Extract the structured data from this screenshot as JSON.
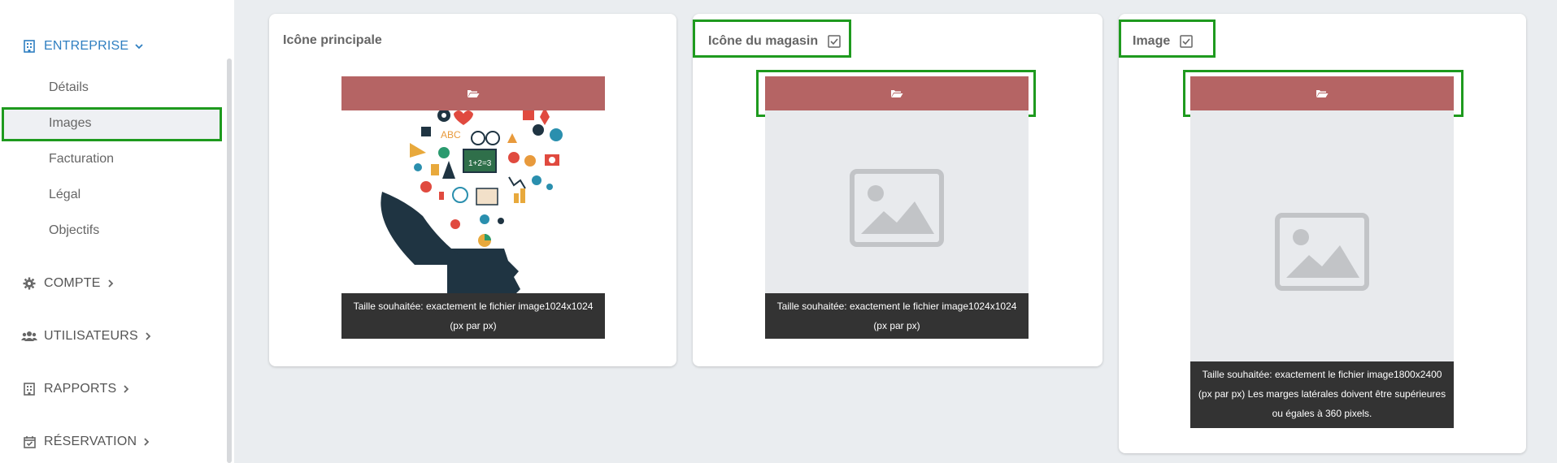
{
  "sidebar": {
    "sections": [
      {
        "label": "ENTREPRISE",
        "icon": "building-icon"
      },
      {
        "label": "COMPTE",
        "icon": "gear-icon"
      },
      {
        "label": "UTILISATEURS",
        "icon": "users-icon"
      },
      {
        "label": "RAPPORTS",
        "icon": "building-icon"
      },
      {
        "label": "RÉSERVATION",
        "icon": "calendar-check-icon"
      }
    ],
    "sub_items": [
      "Détails",
      "Images",
      "Facturation",
      "Légal",
      "Objectifs"
    ],
    "selected": "Images"
  },
  "cards": [
    {
      "title": "Icône principale",
      "caption": "Taille souhaitée: exactement le fichier image1024x1024 (px par px)"
    },
    {
      "title": "Icône du magasin",
      "caption": "Taille souhaitée: exactement le fichier image1024x1024 (px par px)"
    },
    {
      "title": "Image",
      "caption": "Taille souhaitée: exactement le fichier image1800x2400 (px par px) Les marges latérales doivent être supérieures ou égales à 360 pixels."
    }
  ],
  "colors": {
    "accent": "#2f7fc1",
    "upload": "#b56464",
    "highlight": "#1e9a1e"
  }
}
